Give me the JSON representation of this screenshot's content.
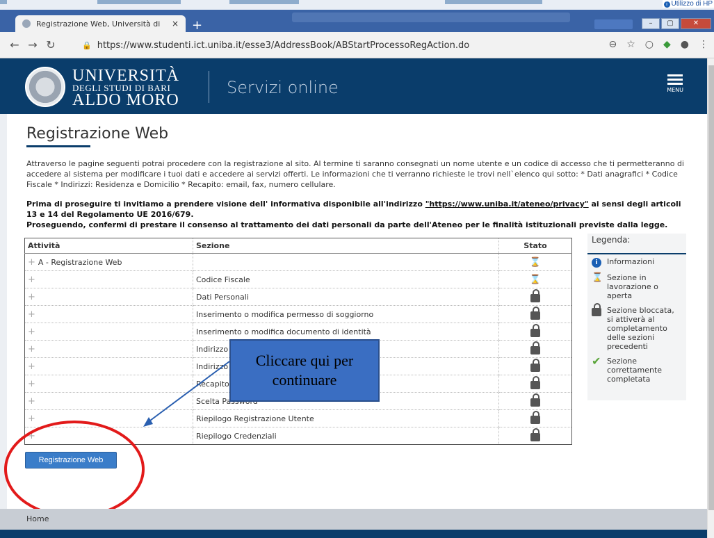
{
  "browser": {
    "tab_title": "Registrazione Web, Università di",
    "tab_close": "×",
    "new_tab": "+",
    "url": "https://www.studenti.ict.uniba.it/esse3/AddressBook/ABStartProcessoRegAction.do",
    "hp_note": "Utilizzo di HP"
  },
  "header": {
    "uni_line1": "UNIVERSITÀ",
    "uni_line2": "DEGLI STUDI DI BARI",
    "uni_line3": "ALDO MORO",
    "services": "Servizi online",
    "menu_label": "MENU"
  },
  "page": {
    "title": "Registrazione Web",
    "intro": "Attraverso le pagine seguenti potrai procedere con la registrazione al sito. Al termine ti saranno consegnati un nome utente e un codice di accesso che ti permetteranno di accedere al sistema per modificare i tuoi dati e accedere ai servizi offerti. Le informazioni che ti verranno richieste le trovi nell`elenco qui sotto: * Dati anagrafici * Codice Fiscale * Indirizzi: Residenza e Domicilio * Recapito: email, fax, numero cellulare.",
    "notice_pre": "Prima di proseguire ti invitiamo a prendere visione dell' informativa disponibile all'indirizzo ",
    "notice_link": "\"https://www.uniba.it/ateneo/privacy\"",
    "notice_post": " ai sensi degli articoli 13 e 14 del Regolamento UE 2016/679.",
    "notice_line2": "Proseguendo, confermi di prestare il consenso al trattamento dei dati personali da parte dell'Ateneo per le finalità istituzionali previste dalla legge."
  },
  "table": {
    "headers": [
      "Attività",
      "Sezione",
      "Stato"
    ],
    "rows": [
      {
        "attivita": "A - Registrazione Web",
        "sezione": "",
        "stato": "hourglass-icon"
      },
      {
        "attivita": "",
        "sezione": "Codice Fiscale",
        "stato": "hourglass-icon"
      },
      {
        "attivita": "",
        "sezione": "Dati Personali",
        "stato": "lock-icon"
      },
      {
        "attivita": "",
        "sezione": "Inserimento o modifica permesso di soggiorno",
        "stato": "lock-icon"
      },
      {
        "attivita": "",
        "sezione": "Inserimento o modifica documento di identità",
        "stato": "lock-icon"
      },
      {
        "attivita": "",
        "sezione": "Indirizzo",
        "stato": "lock-icon"
      },
      {
        "attivita": "",
        "sezione": "Indirizzo",
        "stato": "lock-icon"
      },
      {
        "attivita": "",
        "sezione": "Recapito",
        "stato": "lock-icon"
      },
      {
        "attivita": "",
        "sezione": "Scelta Password",
        "stato": "lock-icon"
      },
      {
        "attivita": "",
        "sezione": "Riepilogo Registrazione Utente",
        "stato": "lock-icon"
      },
      {
        "attivita": "",
        "sezione": "Riepilogo Credenziali",
        "stato": "lock-icon"
      }
    ]
  },
  "legend": {
    "title": "Legenda:",
    "items": [
      {
        "icon": "info-icon",
        "text": "Informazioni"
      },
      {
        "icon": "hourglass-icon",
        "text": "Sezione in lavorazione o aperta"
      },
      {
        "icon": "lock-icon",
        "text": "Sezione bloccata, si attiverà al completamento delle sezioni precedenti"
      },
      {
        "icon": "check-icon",
        "text": "Sezione correttamente completata"
      }
    ]
  },
  "callout": {
    "line1": "Cliccare qui per",
    "line2": "continuare"
  },
  "button": {
    "label": "Registrazione Web"
  },
  "footer": {
    "home": "Home"
  },
  "colors": {
    "header_bg": "#0a3d6b",
    "button_bg": "#3a7dc9",
    "annotation_red": "#e21a1a",
    "callout_bg": "#3a6ec2"
  }
}
